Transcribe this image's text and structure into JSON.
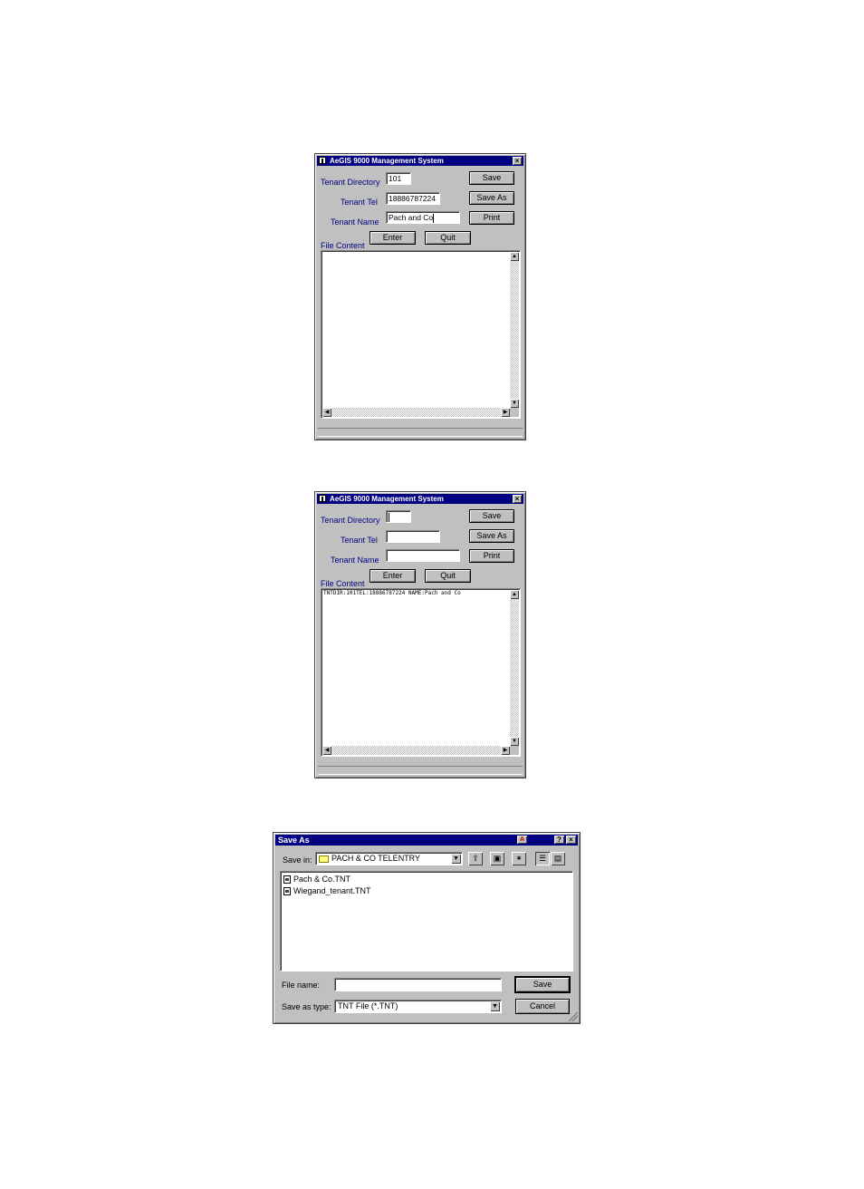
{
  "window1": {
    "title": "AeGIS 9000 Management System",
    "close": "×",
    "labels": {
      "directory": "Tenant Directory",
      "tel": "Tenant Tel",
      "name": "Tenant Name",
      "file_content": "File Content"
    },
    "fields": {
      "directory": "101",
      "tel": "18886787224",
      "name": "Pach and Co"
    },
    "buttons": {
      "save": "Save",
      "save_as": "Save As",
      "print": "Print",
      "enter": "Enter",
      "quit": "Quit"
    },
    "file_content_text": ""
  },
  "window2": {
    "title": "AeGIS 9000 Management System",
    "close": "×",
    "labels": {
      "directory": "Tenant Directory",
      "tel": "Tenant Tel",
      "name": "Tenant Name",
      "file_content": "File Content"
    },
    "fields": {
      "directory": "",
      "tel": "",
      "name": ""
    },
    "buttons": {
      "save": "Save",
      "save_as": "Save As",
      "print": "Print",
      "enter": "Enter",
      "quit": "Quit"
    },
    "file_content_text": "TNTDIR:101TEL:18886787224 NAME:Pach and Co"
  },
  "save_as_dialog": {
    "title": "Save As",
    "help": "?",
    "close": "×",
    "save_in_label": "Save in:",
    "save_in_value": "PACH & CO TELENTRY",
    "files": [
      "Pach & Co.TNT",
      "Wiegand_tenant.TNT"
    ],
    "file_name_label": "File name:",
    "file_name_value": "",
    "save_as_type_label": "Save as type:",
    "save_as_type_value": "TNT File (*.TNT)",
    "save_button": "Save",
    "cancel_button": "Cancel"
  }
}
